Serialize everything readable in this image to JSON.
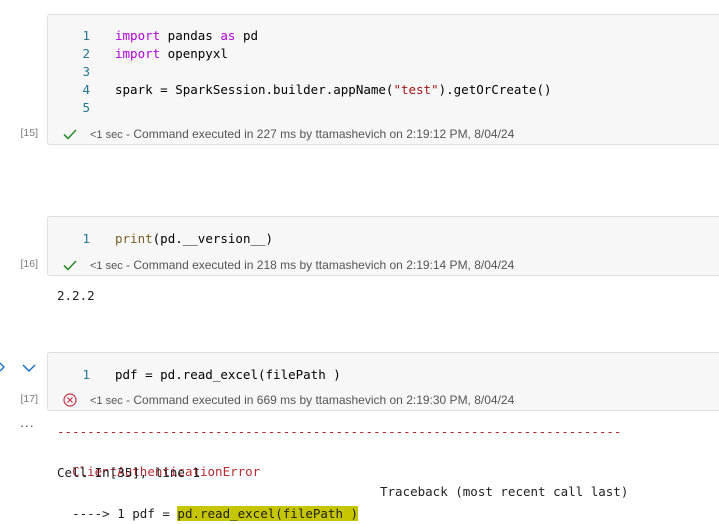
{
  "cells": [
    {
      "exec_count": "[15]",
      "lines": [
        {
          "num": "1",
          "tokens": [
            {
              "t": "import",
              "c": "kw"
            },
            {
              "t": " pandas "
            },
            {
              "t": "as",
              "c": "kw"
            },
            {
              "t": " pd"
            }
          ]
        },
        {
          "num": "2",
          "tokens": [
            {
              "t": "import",
              "c": "kw"
            },
            {
              "t": " openpyxl"
            }
          ]
        },
        {
          "num": "3",
          "tokens": []
        },
        {
          "num": "4",
          "tokens": [
            {
              "t": "spark = SparkSession.builder.appName("
            },
            {
              "t": "\"test\"",
              "c": "str"
            },
            {
              "t": ").getOrCreate()"
            }
          ]
        },
        {
          "num": "5",
          "tokens": []
        }
      ],
      "status": {
        "icon": "check-icon",
        "duration": "<1 sec",
        "text": " - Command executed in 227 ms by ttamashevich on 2:19:12 PM, 8/04/24"
      }
    },
    {
      "exec_count": "[16]",
      "lines": [
        {
          "num": "1",
          "tokens": [
            {
              "t": "print",
              "c": "fn"
            },
            {
              "t": "(pd.__version__)"
            }
          ]
        }
      ],
      "status": {
        "icon": "check-icon",
        "duration": "<1 sec",
        "text": " - Command executed in 218 ms by ttamashevich on 2:19:14 PM, 8/04/24"
      },
      "output": "2.2.2"
    },
    {
      "exec_count": "[17]",
      "lines": [
        {
          "num": "1",
          "tokens": [
            {
              "t": "pdf = pd.read_excel(filePath )"
            }
          ]
        }
      ],
      "status": {
        "icon": "error-circle-icon",
        "duration": "<1 sec",
        "text": " - Command executed in 669 ms by ttamashevich on 2:19:30 PM, 8/04/24"
      },
      "more": "...",
      "traceback": {
        "separator": "---------------------------------------------------------------------------",
        "error_name": "ClientAuthenticationError",
        "traceback_label": "Traceback (most recent call last)",
        "cell_ref": "Cell In[35], line 1",
        "arrow_prefix": "----> 1 pdf = ",
        "highlighted": "pd.read_excel(filePath )"
      }
    }
  ],
  "colors": {
    "keyword": "#af00db",
    "string": "#a31515",
    "error": "#b22b31",
    "success": "#2e8b2e",
    "highlight": "#c5c600"
  }
}
